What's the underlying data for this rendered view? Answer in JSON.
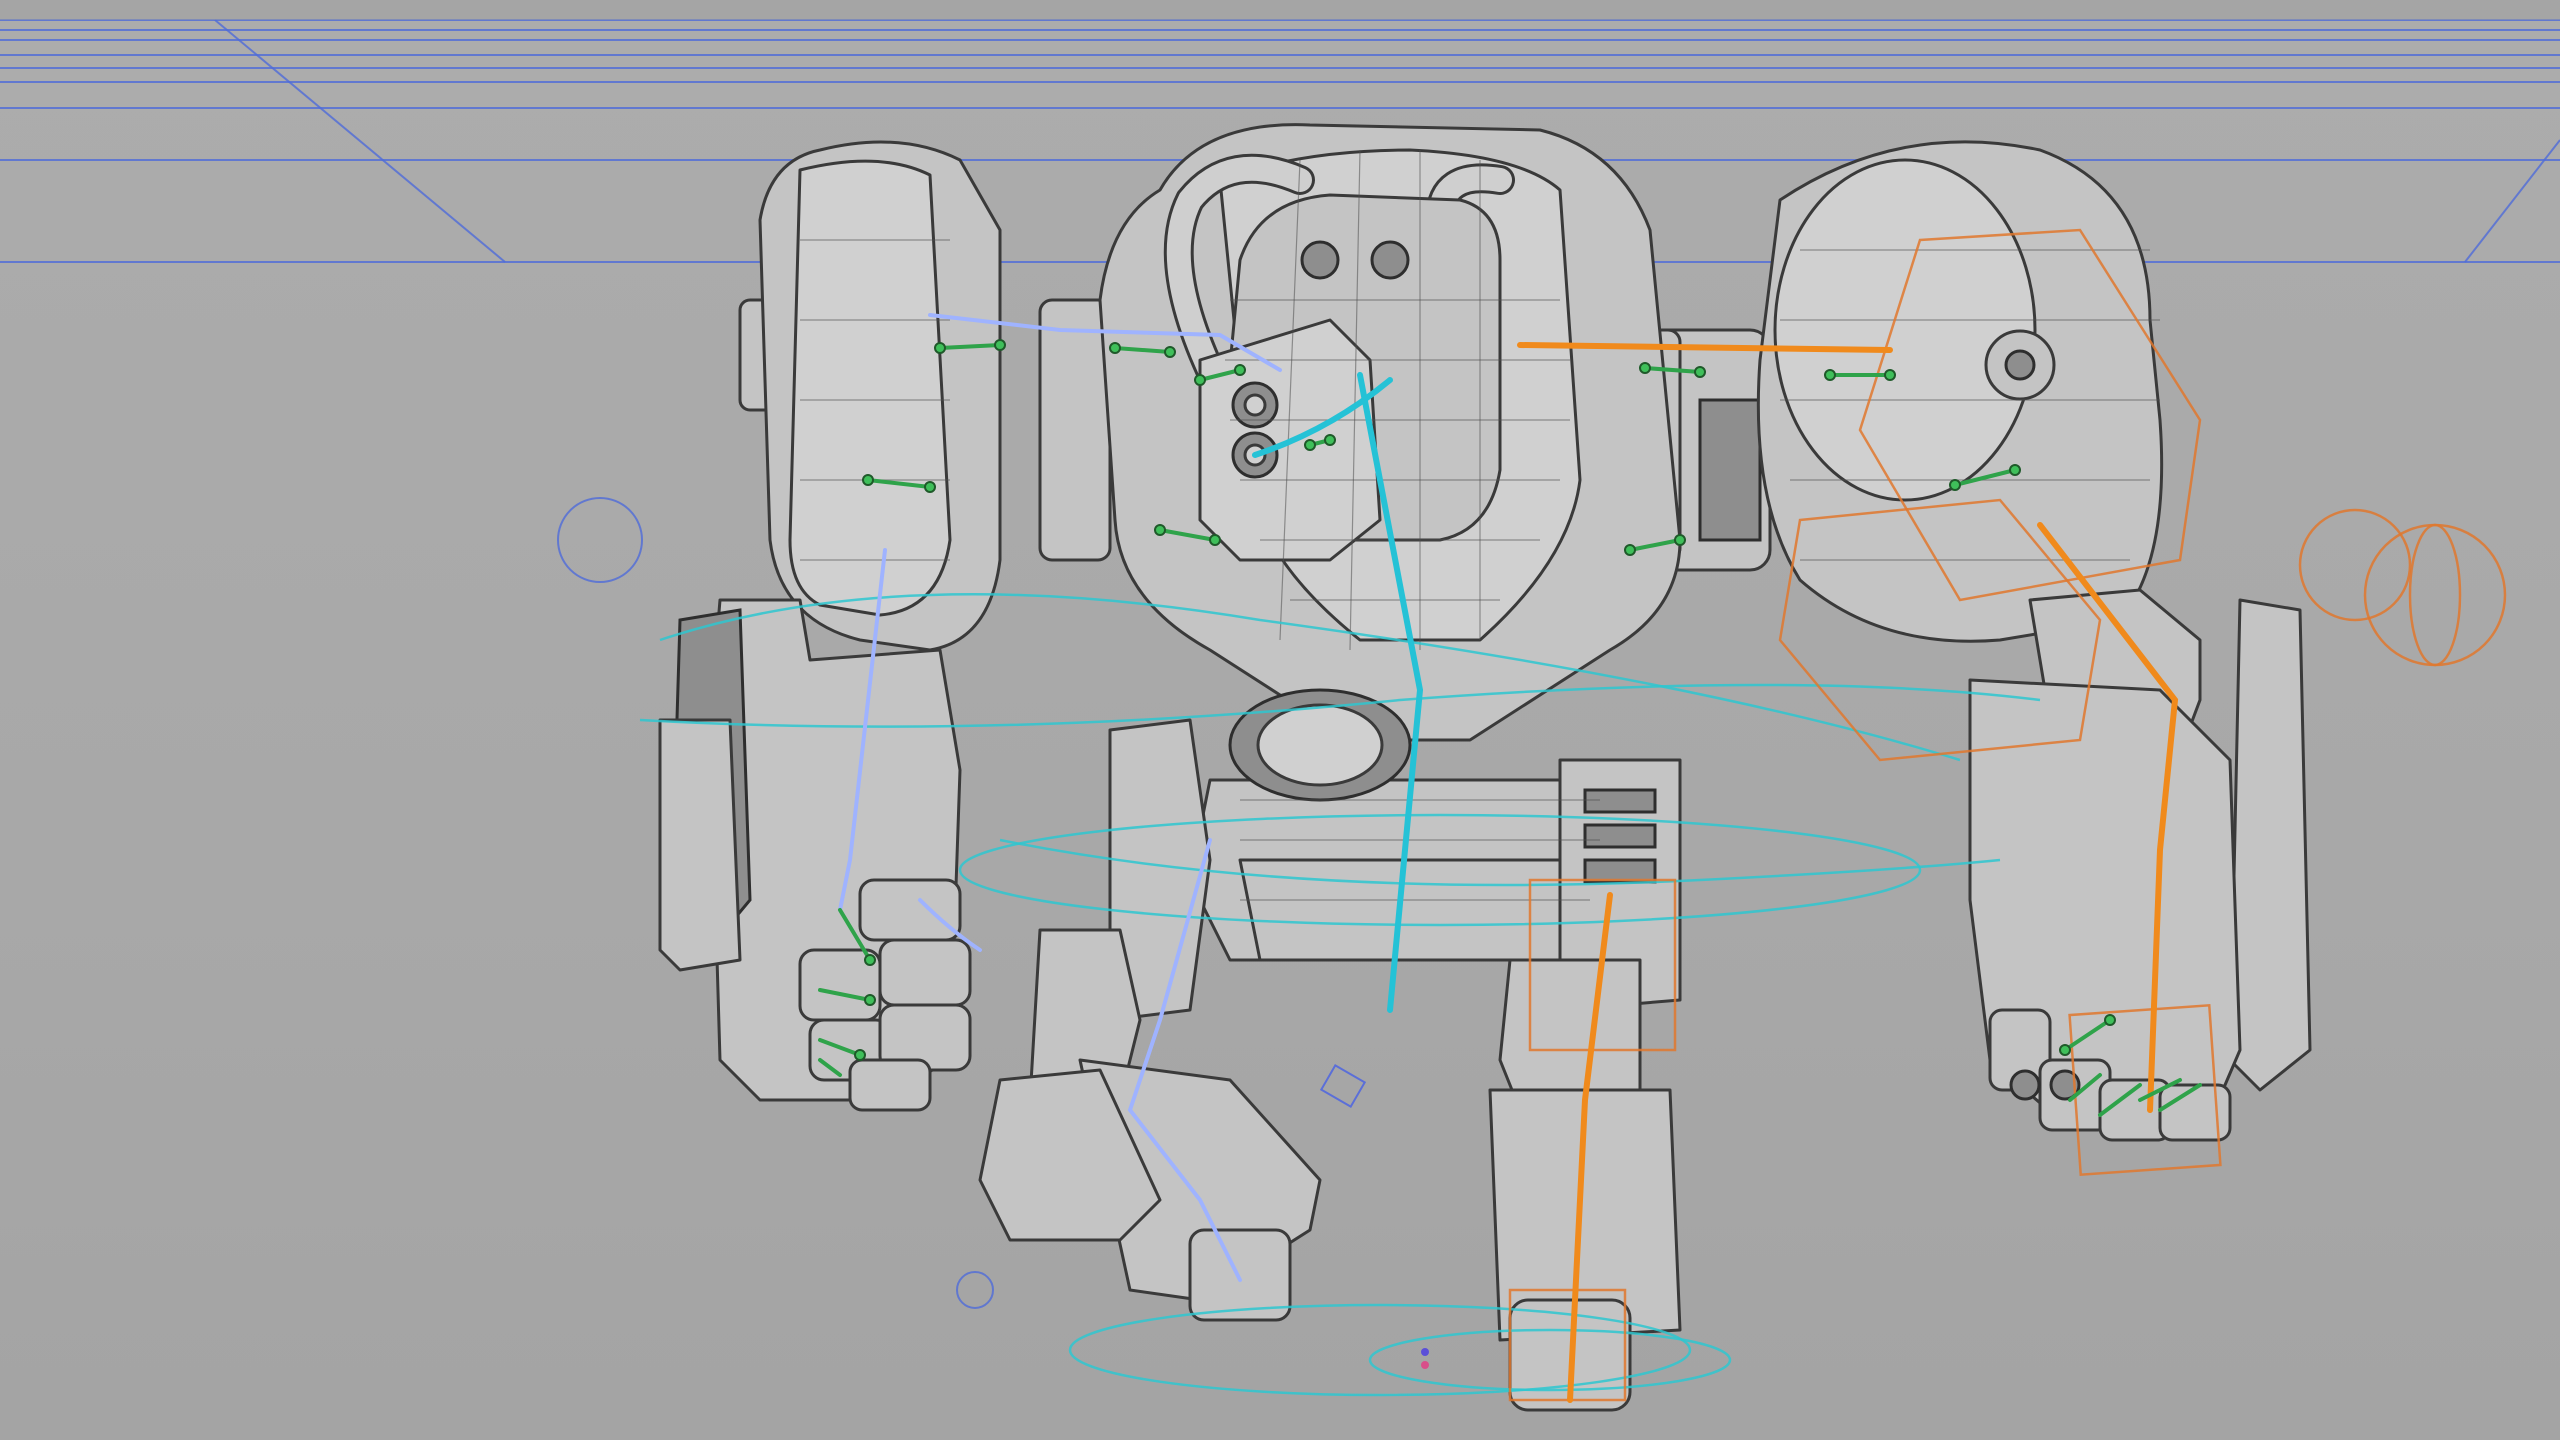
{
  "viewport": {
    "background": "#a9a9a9",
    "reference_line_color": "#4f6bd9",
    "rig_colors": {
      "left_side_bones": "#9fb3ff",
      "right_side_bones": "#f08a1c",
      "spine_bones": "#25c2d6",
      "controllers_cyan": "#2ec7d0",
      "controllers_orange": "#e0782e",
      "joint_markers": "#3fbf5a"
    }
  },
  "model": {
    "icon": "robot-mesh-icon"
  }
}
